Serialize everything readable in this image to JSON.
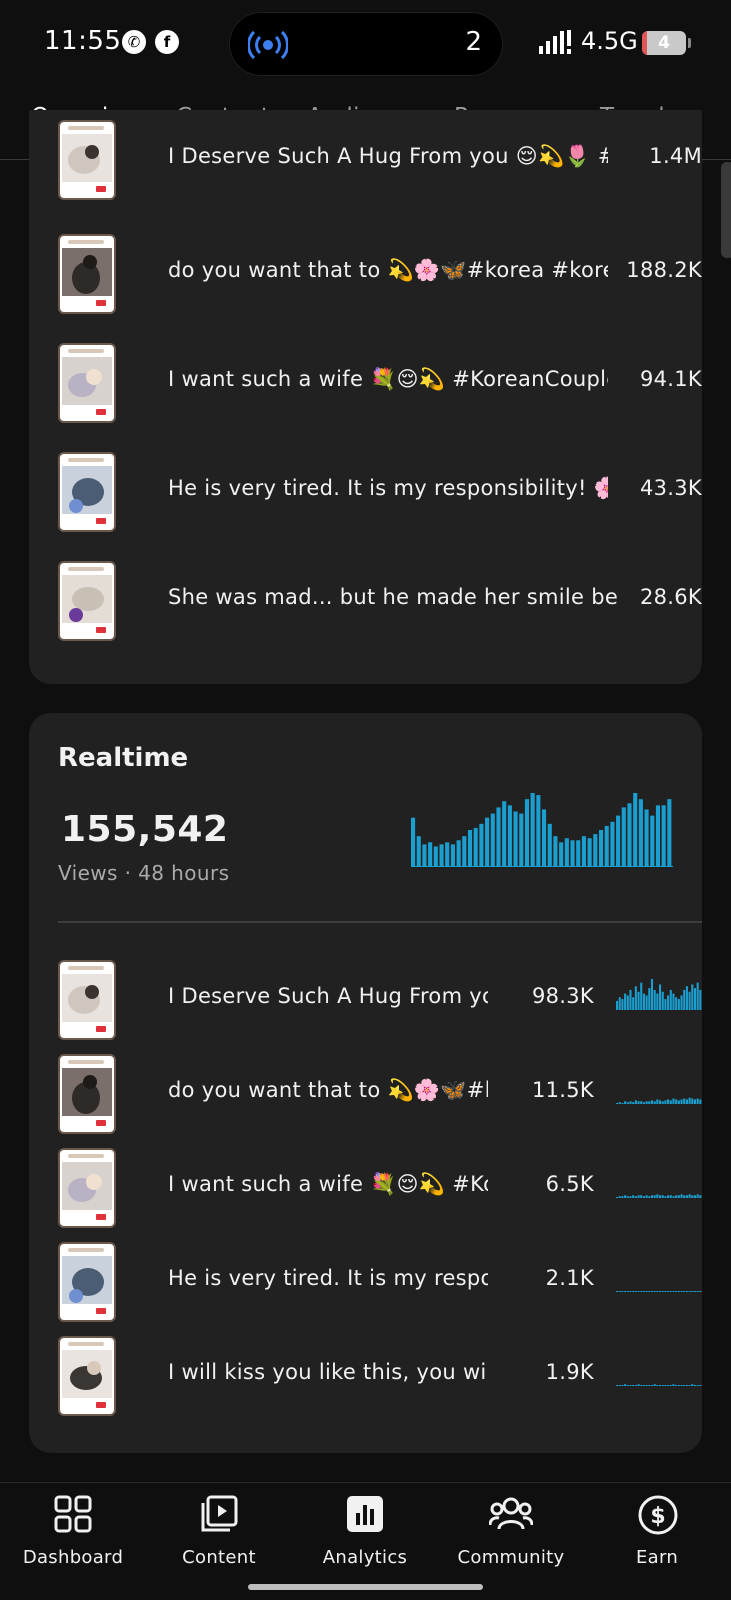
{
  "status_bar": {
    "time": "11:55",
    "island_count": "2",
    "network": "4.5G",
    "battery": "4",
    "battery_level": 0.12
  },
  "tabs": [
    "Overview",
    "Content",
    "Audience",
    "Revenue",
    "Trends"
  ],
  "active_tab": "Overview",
  "top_videos": [
    {
      "title": "I Deserve Such A Hug From you 😌💫🌷 #ko...",
      "value": "1.4M"
    },
    {
      "title": "do you want that to 💫🌸🦋#korea #korean...",
      "value": "188.2K"
    },
    {
      "title": "I want such a wife 💐😌💫 #KoreanCouple #...",
      "value": "94.1K"
    },
    {
      "title": "He is very tired. It is my responsibility! 🌸✨...",
      "value": "43.3K"
    },
    {
      "title": "She was mad... but he made her smile before...",
      "value": "28.6K"
    }
  ],
  "realtime": {
    "heading": "Realtime",
    "count": "155,542",
    "subtitle": "Views · 48 hours",
    "bar_color": "#1a9fd0",
    "chart_data": {
      "type": "bar",
      "values": [
        48,
        30,
        22,
        24,
        20,
        22,
        24,
        22,
        26,
        30,
        36,
        38,
        42,
        48,
        52,
        58,
        64,
        60,
        54,
        52,
        66,
        72,
        70,
        56,
        42,
        30,
        24,
        28,
        26,
        26,
        30,
        28,
        32,
        36,
        40,
        44,
        50,
        58,
        62,
        72,
        66,
        56,
        50,
        60,
        60,
        66
      ]
    },
    "videos": [
      {
        "title": "I Deserve Such A Hug From you...",
        "value": "98.3K",
        "spark": [
          10,
          14,
          12,
          18,
          16,
          22,
          14,
          26,
          20,
          30,
          18,
          16,
          24,
          34,
          22,
          18,
          28,
          20,
          12,
          16,
          22,
          18,
          14,
          12,
          16,
          22,
          26,
          20,
          28,
          24,
          30,
          22
        ]
      },
      {
        "title": "do you want that to 💫🌸🦋#ko...",
        "value": "11.5K",
        "spark": [
          1,
          2,
          1,
          3,
          2,
          3,
          2,
          4,
          3,
          3,
          2,
          3,
          3,
          4,
          3,
          5,
          4,
          3,
          4,
          5,
          4,
          6,
          5,
          4,
          5,
          6,
          5,
          7,
          6,
          5,
          6,
          5
        ]
      },
      {
        "title": "I want such a wife 💐😌💫 #Ko...",
        "value": "6.5K",
        "spark": [
          1,
          2,
          2,
          3,
          2,
          2,
          3,
          2,
          3,
          3,
          2,
          3,
          2,
          3,
          3,
          4,
          3,
          3,
          2,
          3,
          3,
          2,
          3,
          3,
          4,
          3,
          3,
          4,
          3,
          3,
          4,
          3
        ]
      },
      {
        "title": "He is very tired. It is my respon...",
        "value": "2.1K",
        "spark": [
          1,
          1,
          1,
          1,
          1,
          1,
          1,
          1,
          1,
          1,
          1,
          1,
          1,
          1,
          1,
          1,
          1,
          1,
          1,
          1,
          1,
          1,
          1,
          1,
          1,
          1,
          1,
          1,
          1,
          1,
          1,
          1
        ]
      },
      {
        "title": "I will kiss you like this, you will n...",
        "value": "1.9K",
        "spark": [
          1,
          1,
          1,
          2,
          1,
          1,
          1,
          1,
          2,
          1,
          1,
          1,
          1,
          1,
          2,
          1,
          1,
          1,
          1,
          1,
          1,
          2,
          1,
          1,
          1,
          1,
          1,
          1,
          2,
          1,
          1,
          1
        ]
      }
    ]
  },
  "bottom_nav": [
    {
      "label": "Dashboard",
      "icon": "dashboard-grid-icon"
    },
    {
      "label": "Content",
      "icon": "content-play-icon"
    },
    {
      "label": "Analytics",
      "icon": "analytics-bar-icon"
    },
    {
      "label": "Community",
      "icon": "community-people-icon"
    },
    {
      "label": "Earn",
      "icon": "earn-dollar-icon"
    }
  ],
  "accent_color": "#1a9fd0"
}
